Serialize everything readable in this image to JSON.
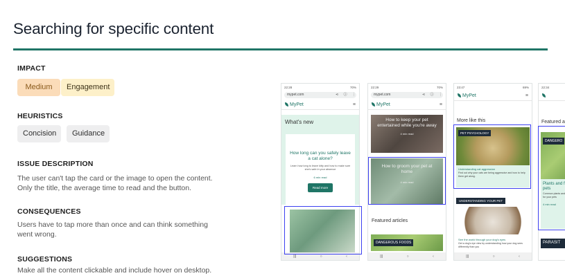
{
  "page": {
    "title": "Searching for specific content"
  },
  "impact": {
    "heading": "IMPACT",
    "tags": [
      "Medium",
      "Engagement"
    ]
  },
  "heuristics": {
    "heading": "HEURISTICS",
    "tags": [
      "Concision",
      "Guidance"
    ]
  },
  "issue": {
    "heading": "ISSUE DESCRIPTION",
    "text": "The user can't tap the card or the image to open the content. Only the title, the average time to read and the button."
  },
  "consequences": {
    "heading": "CONSEQUENCES",
    "text": "Users have to tap more than once and can think something went wrong."
  },
  "suggestions": {
    "heading": "SUGGESTIONS",
    "text": "Make all the content clickable and include hover on desktop."
  },
  "phones": {
    "p1": {
      "time": "22:28",
      "battery": "70%",
      "url": "mypet.com",
      "app_name": "MyPet",
      "section": "What's new",
      "card_title": "How long can you safely leave a cat alone?",
      "card_desc": "Learn how long to leave kitty and how to make sure she's safe in your absence",
      "read_time": "6 min read",
      "button": "Read more"
    },
    "p2": {
      "time": "22:29",
      "battery": "70%",
      "url": "mypet.com",
      "app_name": "MyPet",
      "card1_title": "How to keep your pet entertained while you're away",
      "card1_time": "4 min read",
      "card2_title": "How to groom your pet at home",
      "card2_time": "4 min read",
      "featured": "Featured articles",
      "badge": "DANGEROUS FOODS"
    },
    "p3": {
      "time": "23:47",
      "battery": "69%",
      "app_name": "MyPet",
      "section": "More like this",
      "badge1": "PET PSYCHOLOGY",
      "link1": "Understanding cat aggression",
      "desc1": "Find out why your cats are being aggressive and how to help them get along.",
      "badge2": "UNDERSTANDING YOUR PET",
      "link2": "See the world through your dog's eyes",
      "desc2": "Get a dog's eye view by understanding how your dog sees differently than you"
    },
    "p4": {
      "time": "22:34",
      "section": "Featured a",
      "badge": "DANGERO",
      "title": "Plants and fe your pets",
      "desc": "Common plants and dangerous for your pets",
      "read_time": "4 min read",
      "badge2": "PARASIT"
    }
  }
}
